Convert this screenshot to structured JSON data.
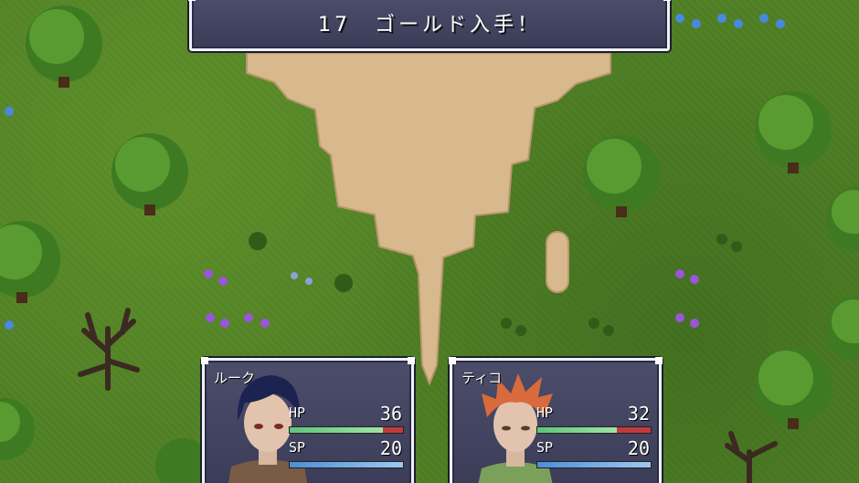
{
  "message": {
    "text": "17　ゴールド入手！"
  },
  "party": [
    {
      "name": "ルーク",
      "hp_label": "HP",
      "hp": "36",
      "hp_fraction": 0.82,
      "sp_label": "SP",
      "sp": "20",
      "sp_fraction": 1.0
    },
    {
      "name": "ティコ",
      "hp_label": "HP",
      "hp": "32",
      "hp_fraction": 0.7,
      "sp_label": "SP",
      "sp": "20",
      "sp_fraction": 1.0
    }
  ],
  "colors": {
    "grass": "#4f7f24",
    "path": "#d8b98e",
    "window": "#3b3c58",
    "hp_bar": "#5fc47a",
    "sp_bar": "#4a8fd8"
  }
}
